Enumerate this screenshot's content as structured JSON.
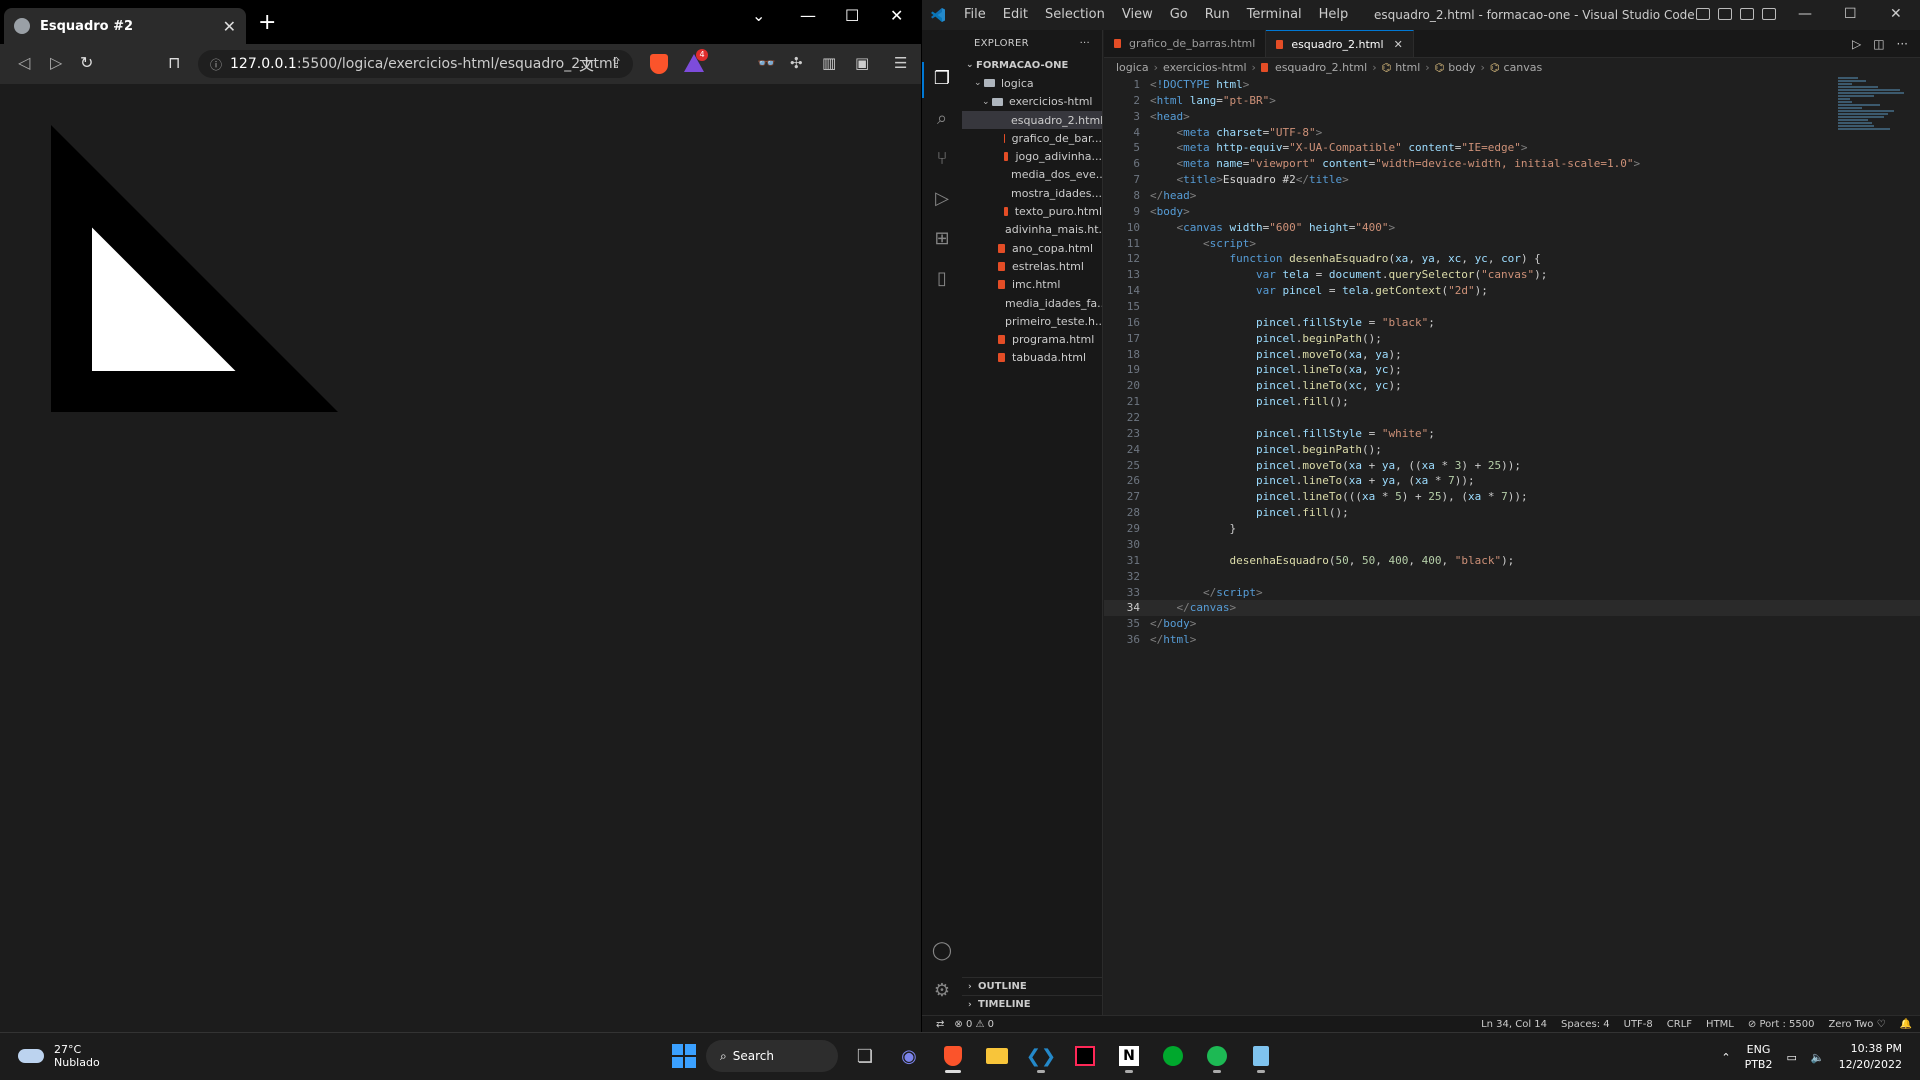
{
  "browser": {
    "tab_title": "Esquadro #2",
    "url_host": "127.0.0.1",
    "url_path": ":5500/logica/exercicios-html/esquadro_2.html",
    "rewards_count": "4",
    "canvas": {
      "xa": 50,
      "ya": 50,
      "xc": 400,
      "yc": 400,
      "fill": "#000000",
      "inner_fill": "#ffffff"
    }
  },
  "vscode": {
    "title": "esquadro_2.html - formacao-one - Visual Studio Code",
    "menu": [
      "File",
      "Edit",
      "Selection",
      "View",
      "Go",
      "Run",
      "Terminal",
      "Help"
    ],
    "explorer": {
      "header": "EXPLORER",
      "root": "FORMACAO-ONE",
      "folder_logica": "logica",
      "folder_exercicios": "exercicios-html",
      "exercicios_files": [
        "esquadro_2.html",
        "grafico_de_bar...",
        "jogo_adivinha...",
        "media_dos_eve...",
        "mostra_idades...",
        "texto_puro.html"
      ],
      "logica_files": [
        "adivinha_mais.ht...",
        "ano_copa.html",
        "estrelas.html",
        "imc.html",
        "media_idades_fa...",
        "primeiro_teste.h...",
        "programa.html",
        "tabuada.html"
      ],
      "outline": "OUTLINE",
      "timeline": "TIMELINE"
    },
    "tabs": [
      "grafico_de_barras.html",
      "esquadro_2.html"
    ],
    "breadcrumb": [
      "logica",
      "exercicios-html",
      "esquadro_2.html",
      "html",
      "body",
      "canvas"
    ],
    "status": {
      "errors": "0",
      "warnings": "0",
      "position": "Ln 34, Col 14",
      "spaces": "Spaces: 4",
      "encoding": "UTF-8",
      "eol": "CRLF",
      "language": "HTML",
      "port": "Port : 5500",
      "theme": "Zero Two"
    }
  },
  "taskbar": {
    "temperature": "27°C",
    "weather": "Nublado",
    "search_label": "Search",
    "lang1": "ENG",
    "lang2": "PTB2",
    "time": "10:38 PM",
    "date": "12/20/2022"
  }
}
